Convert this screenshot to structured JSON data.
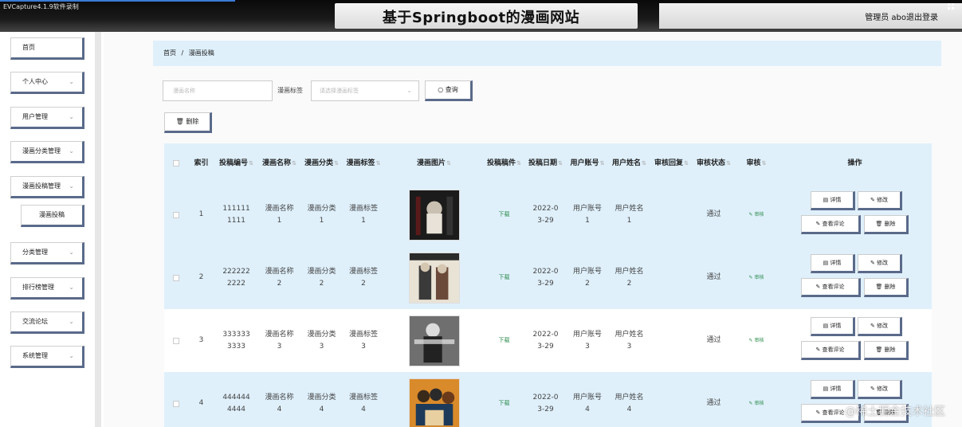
{
  "recorder_label": "EVCapture4.1.9软件录制",
  "header": {
    "title": "基于Springboot的漫画网站",
    "user_label": "管理员 abo",
    "logout_label": "退出登录"
  },
  "sidebar": {
    "items": [
      {
        "label": "首页",
        "chevron": false
      },
      {
        "label": "个人中心",
        "chevron": true
      },
      {
        "label": "用户管理",
        "chevron": true
      },
      {
        "label": "漫画分类管理",
        "chevron": true
      },
      {
        "label": "漫画投稿管理",
        "chevron": true
      },
      {
        "label": "漫画投稿",
        "chevron": false,
        "sub": true
      },
      {
        "label": "分类管理",
        "chevron": true
      },
      {
        "label": "排行榜管理",
        "chevron": true
      },
      {
        "label": "交流论坛",
        "chevron": true
      },
      {
        "label": "系统管理",
        "chevron": true
      }
    ]
  },
  "breadcrumb": {
    "home": "首页",
    "sep": "/",
    "current": "漫画投稿"
  },
  "search": {
    "name_placeholder": "漫画名称",
    "tag_label": "漫画标签",
    "tag_placeholder": "请选择漫画标签",
    "query_label": "查询"
  },
  "toolbar": {
    "delete_label": "删除"
  },
  "table": {
    "headers": [
      "",
      "索引",
      "投稿编号",
      "漫画名称",
      "漫画分类",
      "漫画标签",
      "漫画图片",
      "投稿稿件",
      "投稿日期",
      "用户账号",
      "用户姓名",
      "审核回复",
      "审核状态",
      "审核",
      "操作"
    ],
    "rows": [
      {
        "index": "1",
        "no": "1111111111",
        "name": "漫画名称1",
        "category": "漫画分类1",
        "tag": "漫画标签1",
        "file": "下载",
        "date": "2022-03-29",
        "account": "用户账号1",
        "username": "用户姓名1",
        "reply": "",
        "status": "通过",
        "audit": "审核"
      },
      {
        "index": "2",
        "no": "2222222222",
        "name": "漫画名称2",
        "category": "漫画分类2",
        "tag": "漫画标签2",
        "file": "下载",
        "date": "2022-03-29",
        "account": "用户账号2",
        "username": "用户姓名2",
        "reply": "",
        "status": "通过",
        "audit": "审核"
      },
      {
        "index": "3",
        "no": "3333333333",
        "name": "漫画名称3",
        "category": "漫画分类3",
        "tag": "漫画标签3",
        "file": "下载",
        "date": "2022-03-29",
        "account": "用户账号3",
        "username": "用户姓名3",
        "reply": "",
        "status": "通过",
        "audit": "审核"
      },
      {
        "index": "4",
        "no": "4444444444",
        "name": "漫画名称4",
        "category": "漫画分类4",
        "tag": "漫画标签4",
        "file": "下载",
        "date": "2022-03-29",
        "account": "用户账号4",
        "username": "用户姓名4",
        "reply": "",
        "status": "通过",
        "audit": "审核"
      }
    ],
    "ops": {
      "detail": "详情",
      "edit": "修改",
      "comments": "查看评论",
      "delete": "删除"
    }
  },
  "watermark": "@稀土掘金技术社区",
  "icons": {
    "search": "search-icon",
    "delete": "trash-icon",
    "detail": "doc-icon",
    "edit": "pencil-icon",
    "comment": "pencil-icon"
  },
  "colors": {
    "header_bg": "#111111",
    "row_highlight": "#dff0fb",
    "button_shadow": "#5a6a8a",
    "link": "#2a8a4a"
  }
}
